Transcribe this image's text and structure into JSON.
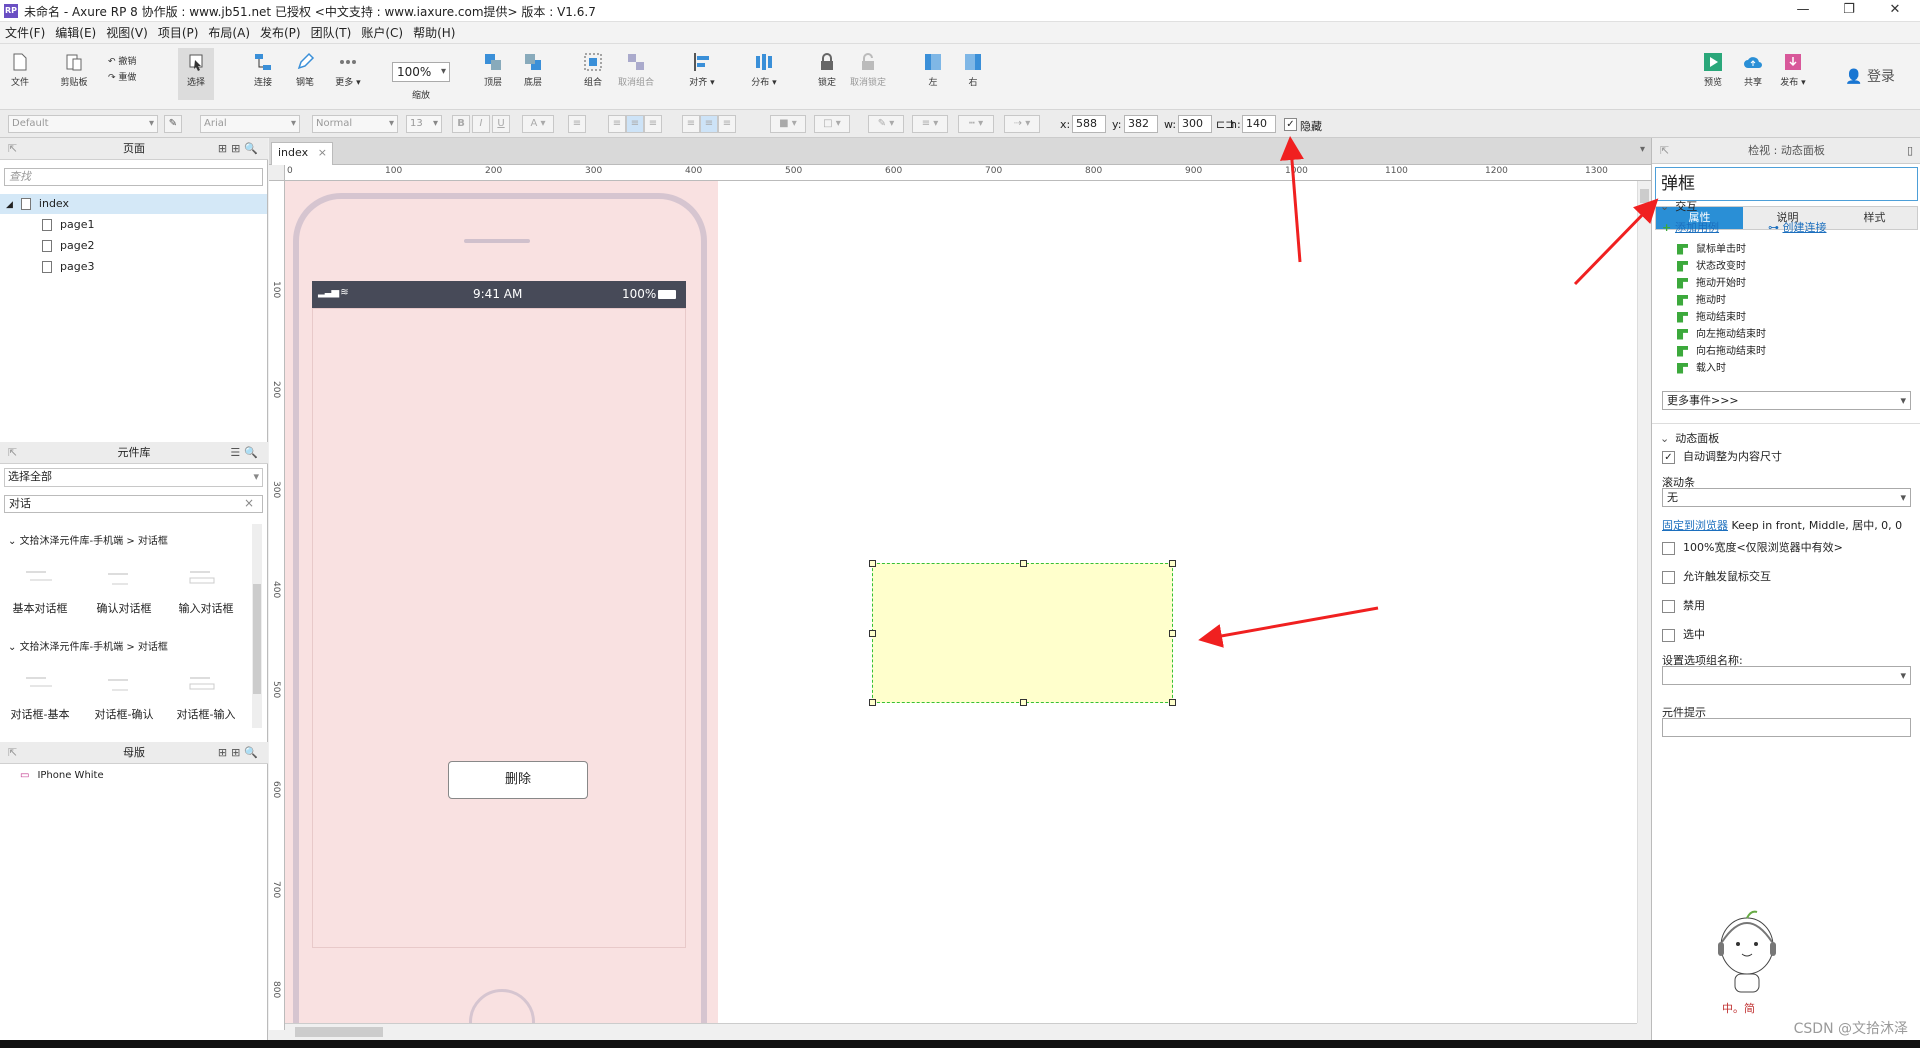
{
  "window": {
    "title": "未命名 - Axure RP 8 协作版 : www.jb51.net  已授权      <中文支持 : www.iaxure.com提供> 版本 : V1.6.7",
    "app_icon": "RP",
    "controls": [
      "—",
      "❐",
      "✕"
    ]
  },
  "menu": [
    "文件(F)",
    "编辑(E)",
    "视图(V)",
    "项目(P)",
    "布局(A)",
    "发布(P)",
    "团队(T)",
    "账户(C)",
    "帮助(H)"
  ],
  "toolbar": {
    "file": "文件",
    "clipboard": "剪贴板",
    "undo": "撤销",
    "redo": "重做",
    "select": "选择",
    "connect": "连接",
    "pen": "钢笔",
    "more": "更多 ▾",
    "zoom_value": "100%",
    "zoom_label": "缩放",
    "top": "顶层",
    "bottom": "底层",
    "group": "组合",
    "ungroup": "取消组合",
    "align": "对齐 ▾",
    "distribute": "分布 ▾",
    "lock": "锁定",
    "unlock": "取消锁定",
    "left": "左",
    "right": "右",
    "preview": "预览",
    "share": "共享",
    "publish": "发布 ▾",
    "login": "登录"
  },
  "format": {
    "style": "Default",
    "font": "Arial",
    "weight": "Normal",
    "size": "13",
    "x_label": "x:",
    "x": "588",
    "y_label": "y:",
    "y": "382",
    "w_label": "w:",
    "w": "300",
    "h_label": "h:",
    "h": "140",
    "hidden_label": "隐藏",
    "hidden_checked": true
  },
  "pages_panel": {
    "title": "页面",
    "search_placeholder": "查找",
    "items": [
      "index",
      "page1",
      "page2",
      "page3"
    ]
  },
  "library_panel": {
    "title": "元件库",
    "select_all": "选择全部",
    "search_value": "对话",
    "group1": "文拾沐泽元件库-手机端 > 对话框",
    "group1_items": [
      "基本对话框",
      "确认对话框",
      "输入对话框"
    ],
    "group2": "文拾沐泽元件库-手机端 > 对话框",
    "group2_items": [
      "对话框-基本",
      "对话框-确认",
      "对话框-输入"
    ]
  },
  "masters_panel": {
    "title": "母版",
    "items": [
      "IPhone White"
    ]
  },
  "canvas": {
    "tab": "index",
    "ruler_top": [
      "0",
      "100",
      "200",
      "300",
      "400",
      "500",
      "600",
      "700",
      "800",
      "900",
      "1000",
      "1100",
      "1200",
      "1300"
    ],
    "ruler_left": [
      "100",
      "200",
      "300",
      "400",
      "500",
      "600",
      "700",
      "800"
    ],
    "status_time": "9:41 AM",
    "status_battery": "100%",
    "delete_button": "删除"
  },
  "inspector": {
    "title": "检视 : 动态面板",
    "name": "弹框",
    "tabs": [
      "属性",
      "说明",
      "样式"
    ],
    "active_tab": "属性",
    "interaction_title": "交互",
    "add_case": "添加用例",
    "create_link": "创建连接",
    "events": [
      "鼠标单击时",
      "状态改变时",
      "拖动开始时",
      "拖动时",
      "拖动结束时",
      "向左拖动结束时",
      "向右拖动结束时",
      "载入时"
    ],
    "more_events": "更多事件>>>",
    "dp_title": "动态面板",
    "auto_fit": "自动调整为内容尺寸",
    "scrollbar_label": "滚动条",
    "scrollbar_value": "无",
    "pin_link": "固定到浏览器",
    "pin_value": "Keep in front, Middle, 居中, 0, 0",
    "full_width": "100%宽度<仅限浏览器中有效>",
    "allow_mouse": "允许触发鼠标交互",
    "disabled": "禁用",
    "selected": "选中",
    "group_name_label": "设置选项组名称:",
    "tooltip_label": "元件提示",
    "sticker_caption": "中。简"
  },
  "watermark": "CSDN @文拾沐泽",
  "colors": {
    "accent": "#2a8fd6",
    "arrow": "#f02020",
    "panel_fill": "#ffffcc",
    "status_bar": "#474a58"
  }
}
